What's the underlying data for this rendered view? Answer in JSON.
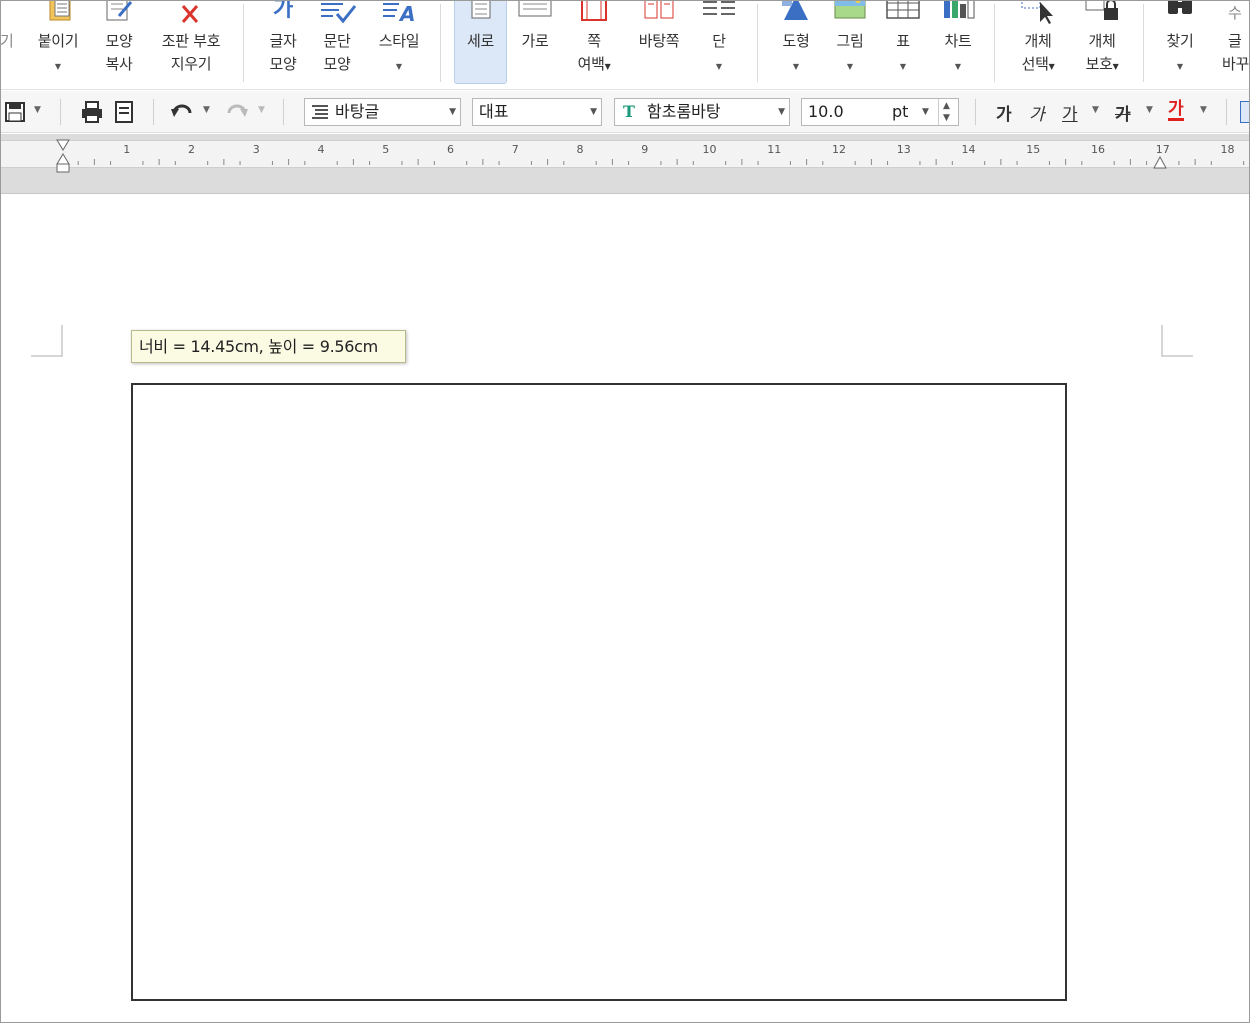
{
  "ribbon": {
    "partial_left_label": "기",
    "paste": {
      "line1": "붙이기"
    },
    "format_copy": {
      "line1": "모양",
      "line2": "복사"
    },
    "clear_marks": {
      "line1": "조판 부호",
      "line2": "지우기"
    },
    "char_shape": {
      "line1": "글자",
      "line2": "모양"
    },
    "para_shape": {
      "line1": "문단",
      "line2": "모양"
    },
    "style": {
      "line1": "스타일"
    },
    "portrait": {
      "line1": "세로"
    },
    "landscape": {
      "line1": "가로"
    },
    "page_margin": {
      "line1": "쪽",
      "line2": "여백"
    },
    "master_page": {
      "line1": "바탕쪽"
    },
    "columns": {
      "line1": "단"
    },
    "shape": {
      "line1": "도형"
    },
    "picture": {
      "line1": "그림"
    },
    "table": {
      "line1": "표"
    },
    "chart": {
      "line1": "차트"
    },
    "object_select": {
      "line1": "개체",
      "line2": "선택"
    },
    "object_protect": {
      "line1": "개체",
      "line2": "보호"
    },
    "find": {
      "line1": "찾기"
    },
    "partial_right": {
      "line0": "수",
      "line1": "글",
      "line2": "바꾸"
    }
  },
  "toolbar": {
    "style_combo": "바탕글",
    "lang_combo": "대표",
    "font_combo": "함초롬바탕",
    "font_size": "10.0",
    "size_unit": "pt",
    "bold_label": "가",
    "italic_label": "가",
    "underline_label": "가",
    "strike_label": "가",
    "color_label": "가"
  },
  "ruler": {
    "numbers": [
      "1",
      "2",
      "3",
      "4",
      "5",
      "6",
      "7",
      "8",
      "9",
      "10",
      "11",
      "12",
      "13",
      "14",
      "15",
      "16",
      "17",
      "18"
    ]
  },
  "tooltip": {
    "text": "너비 = 14.45cm, 높이 = 9.56cm"
  },
  "colors": {
    "accent_icon": "#3b6fc4",
    "close_red": "#d9342b",
    "active_button": "#dce8f7",
    "text_color_red": "#e02020"
  },
  "icons": [
    "paste-icon",
    "format-copy-icon",
    "clear-marks-icon",
    "char-shape-icon",
    "para-shape-icon",
    "style-icon",
    "portrait-icon",
    "landscape-icon",
    "page-margin-icon",
    "master-page-icon",
    "columns-icon",
    "shape-icon",
    "picture-icon",
    "table-icon",
    "chart-icon",
    "object-select-icon",
    "object-protect-icon",
    "find-icon",
    "save-icon",
    "print-icon",
    "preview-icon",
    "undo-icon",
    "redo-icon"
  ]
}
